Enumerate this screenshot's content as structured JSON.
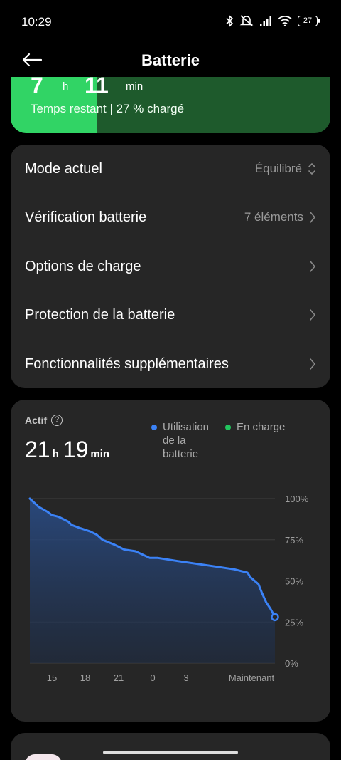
{
  "status_bar": {
    "time": "10:29",
    "battery_level": "27",
    "icons": [
      "bluetooth-icon",
      "mute-icon",
      "signal-icon",
      "wifi-icon",
      "battery-icon"
    ]
  },
  "header": {
    "title": "Batterie"
  },
  "battery_summary": {
    "hours": "7",
    "hours_unit": "h",
    "minutes": "11",
    "minutes_unit": "min",
    "remaining_text": "Temps restant | 27 % chargé",
    "charge_percent": 27,
    "color_full": "#31d465",
    "color_empty": "#1e5a2c"
  },
  "settings": [
    {
      "label": "Mode actuel",
      "value": "Équilibré",
      "icon": "updown-chevron-icon"
    },
    {
      "label": "Vérification batterie",
      "value": "7 éléments",
      "icon": "chevron-right-icon"
    },
    {
      "label": "Options de charge",
      "value": "",
      "icon": "chevron-right-icon"
    },
    {
      "label": "Protection de la batterie",
      "value": "",
      "icon": "chevron-right-icon"
    },
    {
      "label": "Fonctionnalités supplémentaires",
      "value": "",
      "icon": "chevron-right-icon"
    }
  ],
  "usage": {
    "active_label": "Actif",
    "hours": "21",
    "hours_unit": "h",
    "minutes": "19",
    "minutes_unit": "min",
    "legend": [
      {
        "label": "Utilisation de la batterie",
        "color": "#3b82f6"
      },
      {
        "label": "En charge",
        "color": "#22c55e"
      }
    ]
  },
  "chart_data": {
    "type": "area",
    "x_ticks": [
      "15",
      "18",
      "21",
      "0",
      "3",
      "Maintenant"
    ],
    "y_ticks": [
      "100%",
      "75%",
      "50%",
      "25%",
      "0%"
    ],
    "ylim": [
      0,
      100
    ],
    "x_unit": "hours before now",
    "series": [
      {
        "name": "Utilisation de la batterie",
        "color": "#3b82f6",
        "x": [
          0,
          0.8,
          1.6,
          2,
          2.6,
          3.5,
          3.8,
          4.6,
          5.5,
          6.1,
          6.6,
          7.7,
          8.6,
          9.6,
          10.9,
          11.6,
          13.5,
          16.6,
          18.6,
          19.8,
          20.1,
          20.8,
          21.1,
          21.5,
          21.9,
          22.3
        ],
        "values": [
          100,
          95,
          92,
          90,
          89,
          86,
          84,
          82,
          80,
          78,
          75,
          72,
          69,
          68,
          64,
          64,
          62,
          59,
          57,
          55,
          52,
          48,
          43,
          37,
          33,
          28
        ]
      }
    ]
  },
  "home_indicator": true
}
